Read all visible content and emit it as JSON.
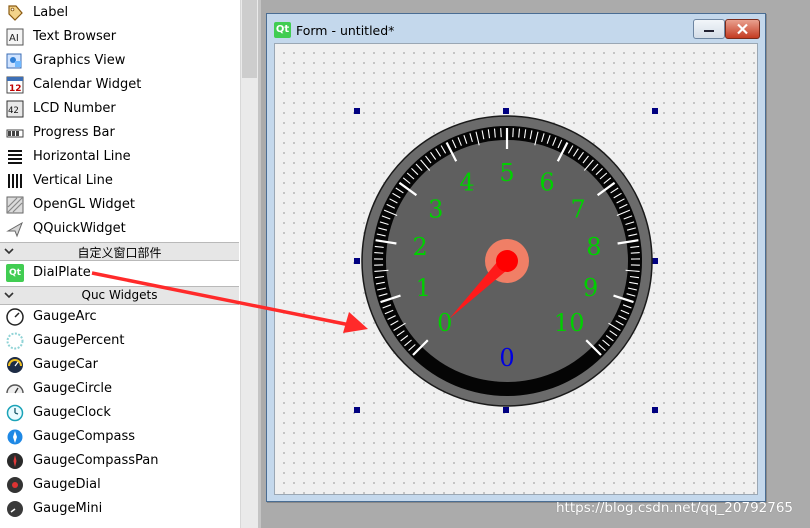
{
  "widget_box": {
    "items_top": [
      {
        "label": "Label",
        "icon": "label-icon"
      },
      {
        "label": "Text Browser",
        "icon": "text-browser-icon"
      },
      {
        "label": "Graphics View",
        "icon": "graphics-view-icon"
      },
      {
        "label": "Calendar Widget",
        "icon": "calendar-icon"
      },
      {
        "label": "LCD Number",
        "icon": "lcd-number-icon"
      },
      {
        "label": "Progress Bar",
        "icon": "progress-bar-icon"
      },
      {
        "label": "Horizontal Line",
        "icon": "horizontal-line-icon"
      },
      {
        "label": "Vertical Line",
        "icon": "vertical-line-icon"
      },
      {
        "label": "OpenGL Widget",
        "icon": "opengl-widget-icon"
      },
      {
        "label": "QQuickWidget",
        "icon": "qquickwidget-icon"
      }
    ],
    "calendar_day": "12",
    "lcd_digits": "42",
    "category_custom": "自定义窗口部件",
    "item_dialplate": {
      "label": "DialPlate",
      "icon": "qt-icon",
      "icon_text": "Qt"
    },
    "category_quc": "Quc Widgets",
    "items_quc": [
      {
        "label": "GaugeArc",
        "icon": "gauge-arc-icon"
      },
      {
        "label": "GaugePercent",
        "icon": "gauge-percent-icon"
      },
      {
        "label": "GaugeCar",
        "icon": "gauge-car-icon"
      },
      {
        "label": "GaugeCircle",
        "icon": "gauge-circle-icon"
      },
      {
        "label": "GaugeClock",
        "icon": "gauge-clock-icon"
      },
      {
        "label": "GaugeCompass",
        "icon": "gauge-compass-icon"
      },
      {
        "label": "GaugeCompassPan",
        "icon": "gauge-compass-pan-icon"
      },
      {
        "label": "GaugeDial",
        "icon": "gauge-dial-icon"
      },
      {
        "label": "GaugeMini",
        "icon": "gauge-mini-icon"
      }
    ]
  },
  "form": {
    "title": "Form - untitled*",
    "logo_text": "Qt"
  },
  "dial": {
    "scale_labels": [
      "0",
      "1",
      "2",
      "3",
      "4",
      "5",
      "6",
      "7",
      "8",
      "9",
      "10"
    ],
    "value": "0",
    "min": 0,
    "max": 10,
    "current": 0,
    "colors": {
      "scale_text": "#00d000",
      "value_text": "#0000e0",
      "pointer": "#ff1a1a",
      "face": "#5f5f5f",
      "ring": "#050505"
    }
  },
  "watermark": "https://blog.csdn.net/qq_20792765"
}
